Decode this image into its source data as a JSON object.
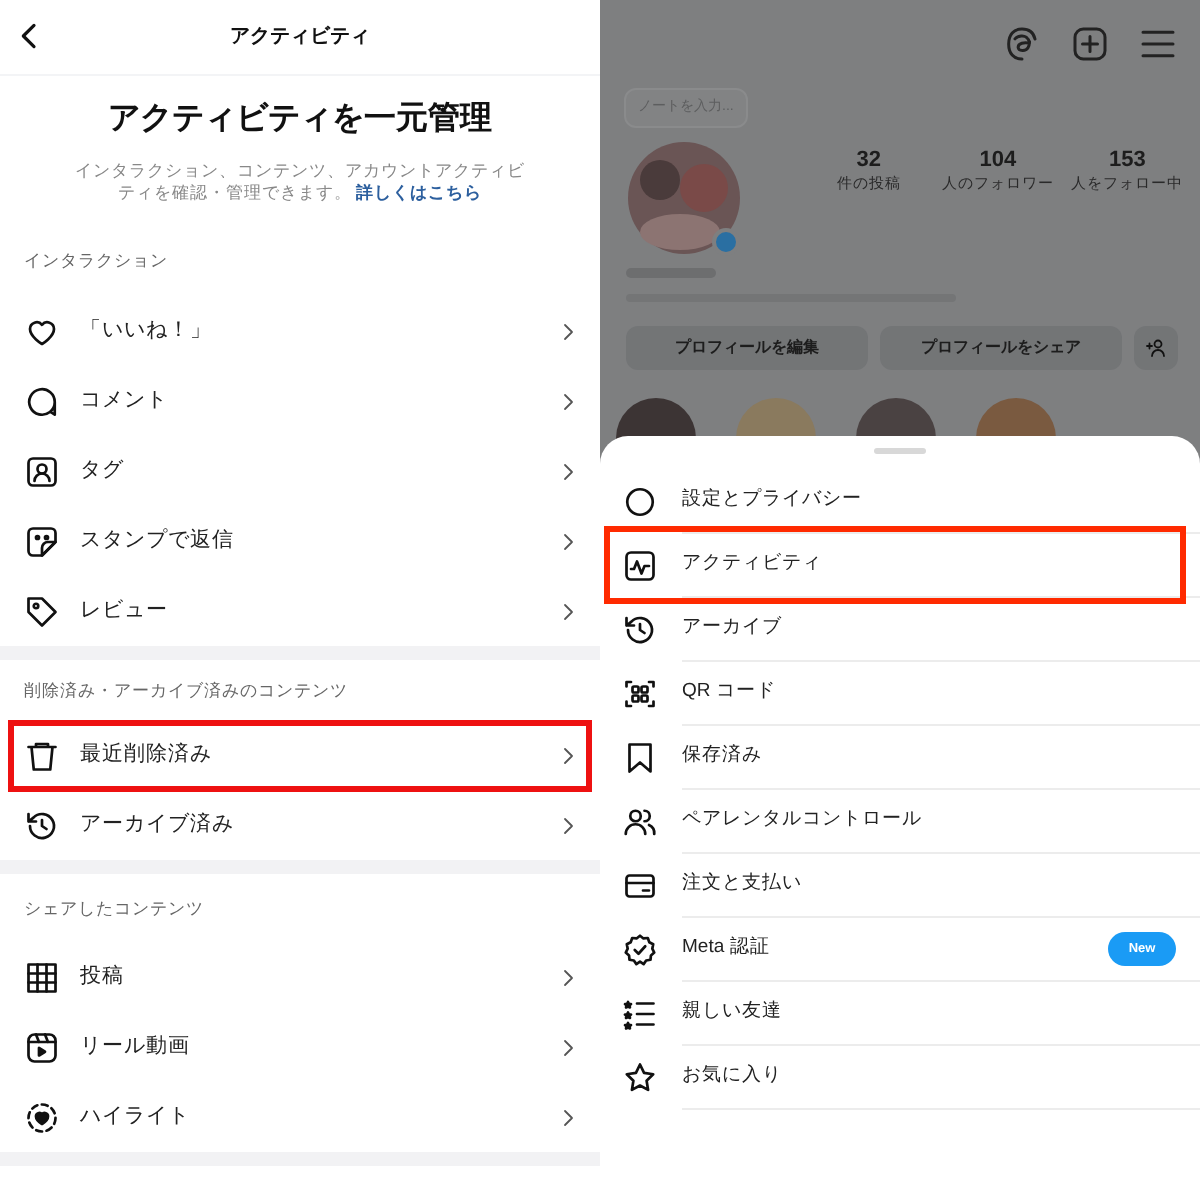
{
  "activity_screen": {
    "header": {
      "title": "アクティビティ"
    },
    "heading": "アクティビティを一元管理",
    "description": "インタラクション、コンテンツ、アカウントアクティビティを確認・管理できます。",
    "link": "詳しくはこちら",
    "sections": [
      {
        "title": "インタラクション",
        "items": [
          {
            "label": "「いいね！」",
            "highlighted": false
          },
          {
            "label": "コメント",
            "highlighted": false
          },
          {
            "label": "タグ",
            "highlighted": false
          },
          {
            "label": "スタンプで返信",
            "highlighted": false
          },
          {
            "label": "レビュー",
            "highlighted": false
          }
        ]
      },
      {
        "title": "削除済み・アーカイブ済みのコンテンツ",
        "items": [
          {
            "label": "最近削除済み",
            "highlighted": true
          },
          {
            "label": "アーカイブ済み",
            "highlighted": false
          }
        ]
      },
      {
        "title": "シェアしたコンテンツ",
        "items": [
          {
            "label": "投稿",
            "highlighted": false
          },
          {
            "label": "リール動画",
            "highlighted": false
          },
          {
            "label": "ハイライト",
            "highlighted": false
          }
        ]
      }
    ]
  },
  "profile_screen": {
    "note_placeholder": "ノートを入力...",
    "stats": [
      {
        "value": "32",
        "label": "件の投稿"
      },
      {
        "value": "104",
        "label": "人のフォロワー"
      },
      {
        "value": "153",
        "label": "人をフォロー中"
      }
    ],
    "buttons": [
      "プロフィールを編集",
      "プロフィールをシェア"
    ],
    "menu": [
      {
        "label": "設定とプライバシー",
        "highlighted": false
      },
      {
        "label": "アクティビティ",
        "highlighted": true
      },
      {
        "label": "アーカイブ",
        "highlighted": false
      },
      {
        "label": "QR コード",
        "highlighted": false
      },
      {
        "label": "保存済み",
        "highlighted": false
      },
      {
        "label": "ペアレンタルコントロール",
        "highlighted": false
      },
      {
        "label": "注文と支払い",
        "highlighted": false
      },
      {
        "label": "Meta 認証",
        "highlighted": false,
        "badge": "New"
      },
      {
        "label": "親しい友達",
        "highlighted": false
      },
      {
        "label": "お気に入り",
        "highlighted": false
      }
    ]
  }
}
